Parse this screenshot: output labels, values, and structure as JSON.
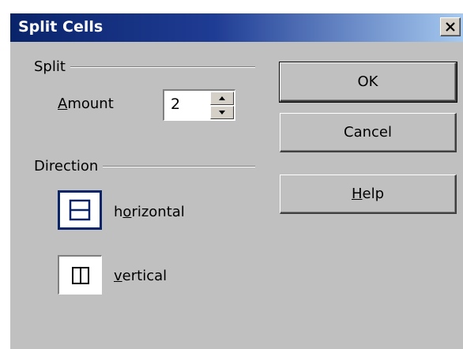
{
  "window": {
    "title": "Split Cells",
    "close_glyph": "✕"
  },
  "split": {
    "group_label": "Split",
    "amount_label": "Amount",
    "amount_value": "2"
  },
  "direction": {
    "group_label": "Direction",
    "options": [
      {
        "label": "horizontal",
        "selected": true
      },
      {
        "label": "vertical",
        "selected": false
      }
    ]
  },
  "buttons": {
    "ok": "OK",
    "cancel": "Cancel",
    "help": "Help"
  },
  "colors": {
    "dialog_bg": "#c0c0c0",
    "title_start": "#0a246a",
    "title_end": "#a6caf0",
    "selection": "#0a246a"
  }
}
